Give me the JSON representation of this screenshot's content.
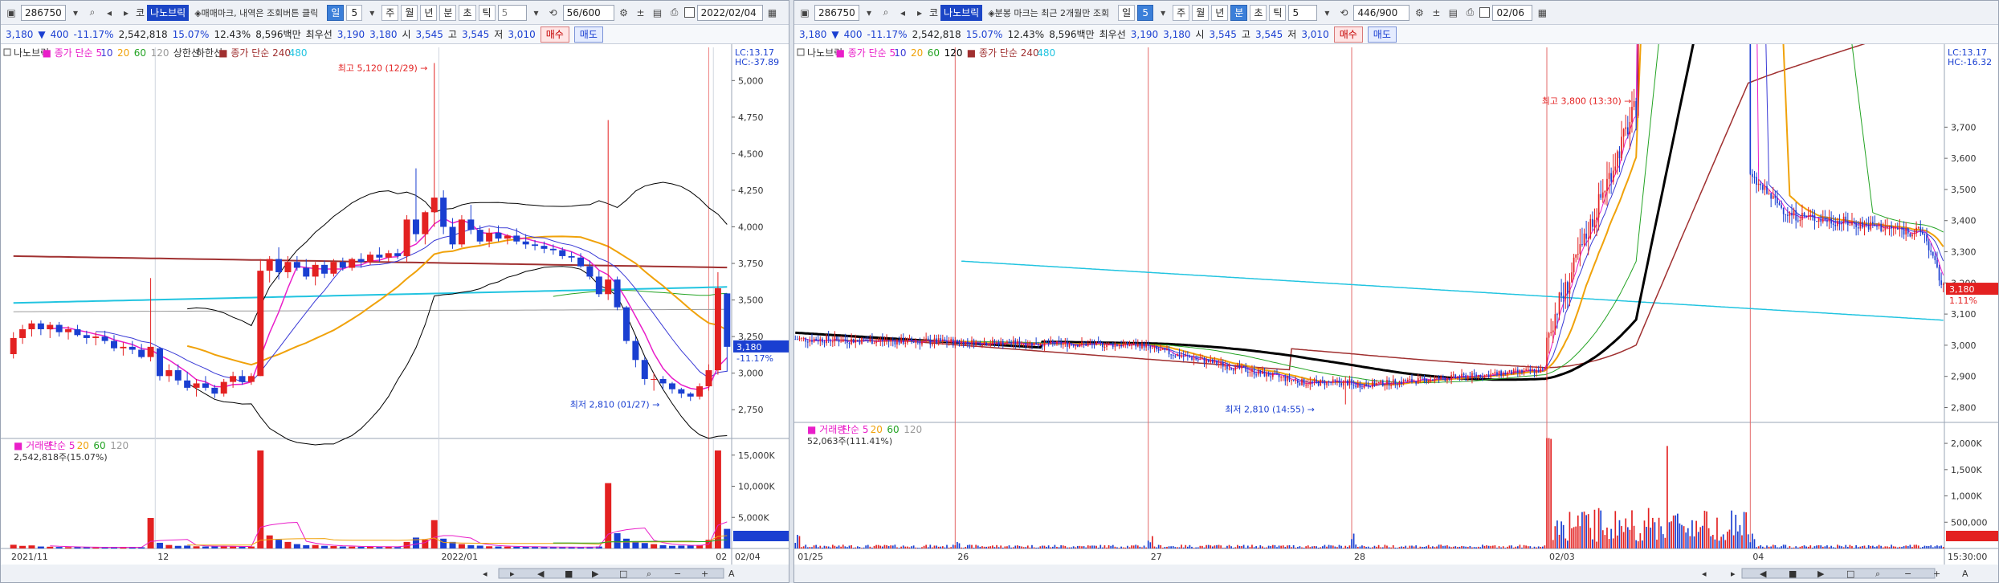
{
  "colors": {
    "up": "#e32121",
    "down": "#1a3fd1",
    "ma5": "#e91ec9",
    "ma10": "#3a3ad6",
    "ma20": "#f0a20a",
    "ma60": "#23a323",
    "ma120": "#9a9a9a",
    "ma240": "#a03030",
    "ma480": "#22c4e0",
    "band": "#000000"
  },
  "left": {
    "toolbar": {
      "code": "286750",
      "market_prefix": "코",
      "name": "나노브릭",
      "hint": "◈매매마크, 내역은 조회버튼 클릭",
      "periods": [
        "일",
        "주",
        "월",
        "년",
        "분",
        "초",
        "틱"
      ],
      "active_period": "일",
      "period_num": "5",
      "count": "5",
      "range": "56/600",
      "date": "2022/02/04"
    },
    "info": {
      "price": "3,180",
      "arrow": "▼",
      "change": "400",
      "rate": "-11.17%",
      "volume": "2,542,818",
      "turnover": "15.07%",
      "vol_ratio": "12.43%",
      "amount": "8,596백만",
      "best_label": "최우선",
      "ask": "3,190",
      "bid": "3,180",
      "open_label": "시",
      "open": "3,545",
      "high_label": "고",
      "high": "3,545",
      "low_label": "저",
      "low": "3,010",
      "buy": "매수",
      "sell": "매도"
    },
    "legend": {
      "name": "나노브릭",
      "sma": "종가 단순 5",
      "p10": "10",
      "p20": "20",
      "p60": "60",
      "p120": "120",
      "upper": "상한선",
      "lower": "하한선",
      "sma2": "종가 단순 240",
      "p480": "480"
    },
    "lc": "LC:13.17",
    "hc": "HC:-37.89",
    "volume_legend": {
      "name": "거래량",
      "sma": "단순 5",
      "p20": "20",
      "p60": "60",
      "p120": "120",
      "value": "2,542,818주(15.07%)"
    },
    "bottom": {
      "date": "02/04"
    }
  },
  "right": {
    "toolbar": {
      "code": "286750",
      "market_prefix": "코",
      "name": "나노브릭",
      "hint": "◈분봉 마크는 최근 2개월만 조회",
      "periods": [
        "일",
        "주",
        "월",
        "년",
        "분",
        "초",
        "틱"
      ],
      "active_period": "분",
      "period_num": "5",
      "count": "5",
      "range": "446/900",
      "date": "02/06"
    },
    "info": {
      "price": "3,180",
      "arrow": "▼",
      "change": "400",
      "rate": "-11.17%",
      "volume": "2,542,818",
      "turnover": "15.07%",
      "vol_ratio": "12.43%",
      "amount": "8,596백만",
      "best_label": "최우선",
      "ask": "3,190",
      "bid": "3,180",
      "open_label": "시",
      "open": "3,545",
      "high_label": "고",
      "high": "3,545",
      "low_label": "저",
      "low": "3,010",
      "buy": "매수",
      "sell": "매도"
    },
    "legend": {
      "name": "나노브릭",
      "sma": "종가 단순 5",
      "p10": "10",
      "p20": "20",
      "p60": "60",
      "p120": "120",
      "sma2": "종가 단순 240",
      "p480": "480"
    },
    "lc": "LC:13.17",
    "hc": "HC:-16.32",
    "volume_legend": {
      "name": "거래량",
      "sma": "단순 5",
      "p20": "20",
      "p60": "60",
      "p120": "120",
      "value": "52,063주(111.41%)"
    },
    "bottom": {
      "time": "15:30:00"
    }
  },
  "chart_data": [
    {
      "type": "candlestick",
      "title": "나노브릭 일봉",
      "ylim": [
        2570,
        5150
      ],
      "yticks": [
        "5,000",
        "4,750",
        "4,500",
        "4,250",
        "4,000",
        "3,750",
        "3,500",
        "3,250",
        "3,000",
        "2,750"
      ],
      "x_labels": [
        {
          "i": 0,
          "label": "2021/11"
        },
        {
          "i": 16,
          "label": "12"
        },
        {
          "i": 47,
          "label": "2022/01"
        },
        {
          "i": 77,
          "label": "02"
        }
      ],
      "candles": [
        [
          3130,
          3280,
          3100,
          3240,
          170
        ],
        [
          3240,
          3330,
          3200,
          3300,
          120
        ],
        [
          3300,
          3360,
          3250,
          3340,
          140
        ],
        [
          3340,
          3360,
          3260,
          3300,
          90
        ],
        [
          3300,
          3350,
          3240,
          3330,
          80
        ],
        [
          3330,
          3350,
          3250,
          3280,
          70
        ],
        [
          3280,
          3320,
          3230,
          3300,
          60
        ],
        [
          3300,
          3330,
          3250,
          3260,
          65
        ],
        [
          3260,
          3290,
          3200,
          3240,
          55
        ],
        [
          3240,
          3280,
          3190,
          3250,
          50
        ],
        [
          3250,
          3290,
          3200,
          3220,
          55
        ],
        [
          3220,
          3260,
          3150,
          3170,
          60
        ],
        [
          3170,
          3210,
          3120,
          3180,
          55
        ],
        [
          3180,
          3220,
          3130,
          3160,
          50
        ],
        [
          3160,
          3200,
          3100,
          3110,
          55
        ],
        [
          3110,
          3650,
          3080,
          3180,
          1400
        ],
        [
          3170,
          3180,
          2950,
          2980,
          260
        ],
        [
          2980,
          3060,
          2940,
          3020,
          160
        ],
        [
          3020,
          3060,
          2920,
          2950,
          120
        ],
        [
          2950,
          3010,
          2880,
          2900,
          130
        ],
        [
          2900,
          2960,
          2840,
          2930,
          100
        ],
        [
          2930,
          2980,
          2880,
          2900,
          90
        ],
        [
          2900,
          2920,
          2830,
          2860,
          100
        ],
        [
          2860,
          2960,
          2840,
          2940,
          110
        ],
        [
          2940,
          3010,
          2900,
          2980,
          90
        ],
        [
          2980,
          3020,
          2920,
          2940,
          80
        ],
        [
          2940,
          3000,
          2920,
          2980,
          90
        ],
        [
          2980,
          3780,
          2980,
          3700,
          4500
        ],
        [
          3700,
          3800,
          3620,
          3780,
          600
        ],
        [
          3780,
          3860,
          3640,
          3690,
          400
        ],
        [
          3690,
          3800,
          3650,
          3760,
          300
        ],
        [
          3760,
          3800,
          3700,
          3720,
          200
        ],
        [
          3720,
          3780,
          3640,
          3660,
          150
        ],
        [
          3660,
          3760,
          3600,
          3740,
          160
        ],
        [
          3740,
          3770,
          3650,
          3680,
          120
        ],
        [
          3680,
          3780,
          3660,
          3760,
          110
        ],
        [
          3760,
          3790,
          3700,
          3720,
          90
        ],
        [
          3720,
          3790,
          3700,
          3780,
          85
        ],
        [
          3780,
          3820,
          3720,
          3760,
          80
        ],
        [
          3760,
          3830,
          3740,
          3810,
          90
        ],
        [
          3810,
          3860,
          3760,
          3790,
          70
        ],
        [
          3790,
          3840,
          3760,
          3820,
          75
        ],
        [
          3820,
          3850,
          3780,
          3800,
          65
        ],
        [
          3800,
          4080,
          3760,
          4050,
          300
        ],
        [
          4050,
          4400,
          3900,
          3950,
          500
        ],
        [
          3950,
          4110,
          3880,
          4100,
          400
        ],
        [
          4100,
          5120,
          4000,
          4200,
          1300
        ],
        [
          4200,
          4250,
          3950,
          4000,
          450
        ],
        [
          4000,
          4060,
          3850,
          3880,
          300
        ],
        [
          3880,
          4080,
          3860,
          4050,
          200
        ],
        [
          4050,
          4150,
          3950,
          3980,
          150
        ],
        [
          3980,
          4010,
          3880,
          3900,
          130
        ],
        [
          3900,
          3990,
          3860,
          3960,
          100
        ],
        [
          3960,
          4010,
          3900,
          3920,
          90
        ],
        [
          3920,
          3950,
          3880,
          3940,
          85
        ],
        [
          3940,
          3990,
          3880,
          3900,
          80
        ],
        [
          3900,
          3950,
          3850,
          3880,
          75
        ],
        [
          3880,
          3910,
          3840,
          3870,
          70
        ],
        [
          3870,
          3900,
          3820,
          3850,
          65
        ],
        [
          3850,
          3880,
          3810,
          3840,
          60
        ],
        [
          3840,
          3860,
          3780,
          3800,
          60
        ],
        [
          3800,
          3830,
          3760,
          3790,
          55
        ],
        [
          3790,
          3820,
          3720,
          3730,
          60
        ],
        [
          3730,
          3770,
          3640,
          3660,
          70
        ],
        [
          3660,
          3700,
          3520,
          3540,
          90
        ],
        [
          3540,
          4730,
          3500,
          3640,
          3000
        ],
        [
          3640,
          3660,
          3430,
          3450,
          700
        ],
        [
          3450,
          3460,
          3200,
          3220,
          450
        ],
        [
          3220,
          3250,
          3040,
          3090,
          300
        ],
        [
          3090,
          3110,
          2920,
          2960,
          250
        ],
        [
          2960,
          3000,
          2880,
          2960,
          200
        ],
        [
          2960,
          2980,
          2890,
          2930,
          150
        ],
        [
          2930,
          2940,
          2860,
          2890,
          120
        ],
        [
          2890,
          2900,
          2830,
          2860,
          130
        ],
        [
          2860,
          2870,
          2810,
          2840,
          140
        ],
        [
          2840,
          2930,
          2820,
          2910,
          160
        ],
        [
          2910,
          3060,
          2880,
          3020,
          400
        ],
        [
          3020,
          3690,
          2990,
          3580,
          4500
        ],
        [
          3545,
          3545,
          3010,
          3180,
          900
        ]
      ]
    },
    {
      "type": "candlestick",
      "title": "나노브릭 5분봉",
      "ylim": [
        2760,
        3920
      ],
      "yticks": [
        "3,700",
        "3,600",
        "3,500",
        "3,400",
        "3,300",
        "3,200",
        "3,100",
        "3,000",
        "2,900",
        "2,800"
      ],
      "x_labels": [
        {
          "i": 0,
          "label": "01/25"
        },
        {
          "i": 77,
          "label": "26"
        },
        {
          "i": 170,
          "label": "27"
        },
        {
          "i": 268,
          "label": "28"
        },
        {
          "i": 362,
          "label": "02/03"
        },
        {
          "i": 460,
          "label": "04"
        }
      ],
      "vlines": [
        77,
        170,
        268,
        362,
        460
      ],
      "days": [
        {
          "start": 0,
          "n": 77,
          "o": 3020,
          "c": 3010,
          "amp": 25
        },
        {
          "start": 77,
          "n": 93,
          "o": 3010,
          "c": 3000,
          "amp": 20
        },
        {
          "start": 170,
          "n": 98,
          "o": 2990,
          "c": 2880,
          "amp": 22
        },
        {
          "start": 268,
          "n": 94,
          "o": 2870,
          "c": 2920,
          "amp": 20
        },
        {
          "start": 362,
          "n": 98,
          "o": 3020,
          "c": 3580,
          "amp": 70
        },
        {
          "start": 460,
          "n": 94,
          "o": 3545,
          "c": 3180,
          "amp": 35
        }
      ],
      "annotations": [
        {
          "label": "최고 3,800 (13:30)"
        },
        {
          "label": "최저 2,810 (14:55)"
        }
      ],
      "ma_tail": {
        "ma480_start": 3270,
        "ma480_end": 3080
      }
    }
  ]
}
